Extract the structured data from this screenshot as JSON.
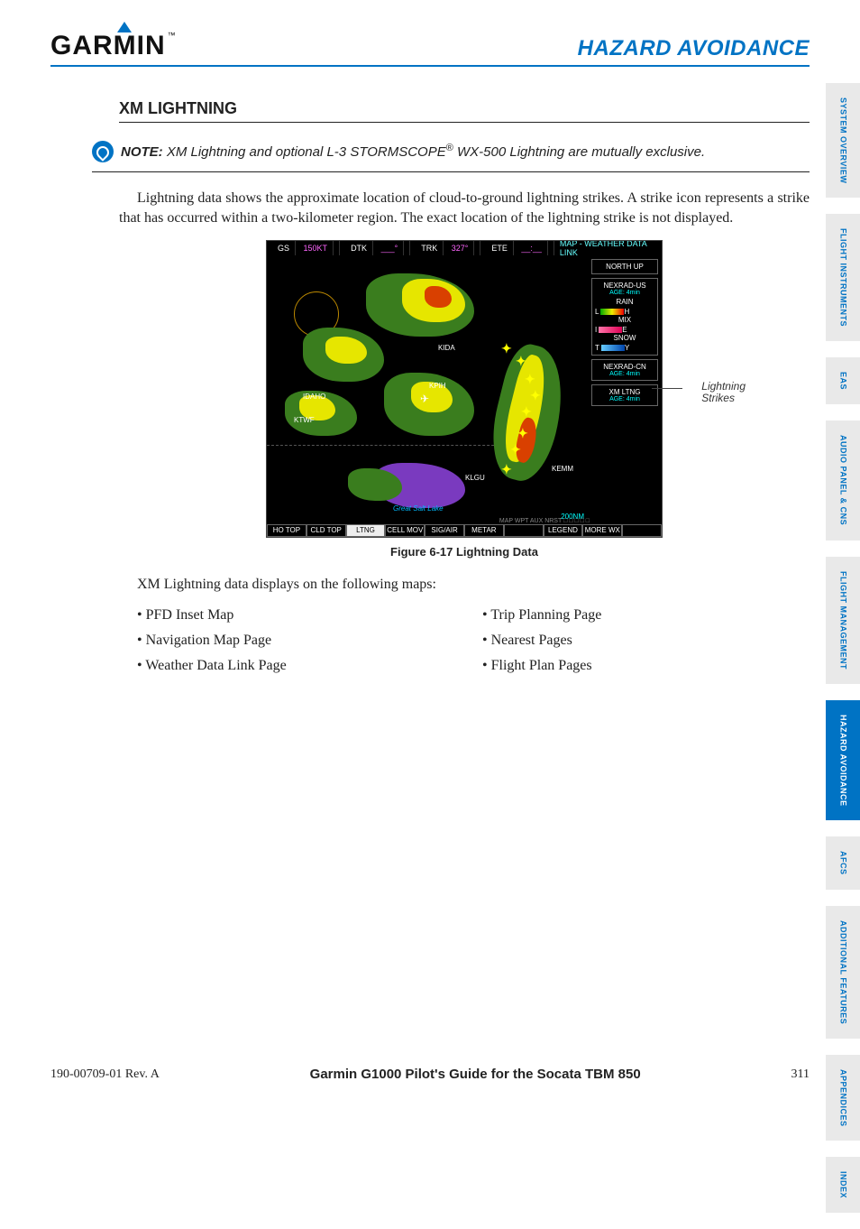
{
  "header": {
    "logo_text": "GARMIN",
    "title": "HAZARD AVOIDANCE"
  },
  "content": {
    "section_title": "XM LIGHTNING",
    "note_label": "NOTE:",
    "note_text": " XM Lightning and optional L-3 STORMSCOPE",
    "note_text2": " WX-500 Lightning are mutually exclusive.",
    "para1": "Lightning data shows the approximate location of cloud-to-ground lightning strikes. A strike icon represents a strike that has occurred within a two-kilometer region. The exact location of the lightning strike is not displayed.",
    "figure": {
      "top_bar": {
        "gs_label": "GS",
        "gs_val": "150KT",
        "dtk_label": "DTK",
        "dtk_val": "___°",
        "trk_label": "TRK",
        "trk_val": "327°",
        "ete_label": "ETE",
        "ete_val": "__:__",
        "title": "MAP - WEATHER DATA LINK"
      },
      "side_panel": {
        "north": "NORTH UP",
        "nexrad_us": "NEXRAD-US",
        "age1": "AGE: 4min",
        "rain": "RAIN",
        "mix": "MIX",
        "snow": "SNOW",
        "nexrad_cn": "NEXRAD-CN",
        "age2": "AGE: 4min",
        "xm": "XM LTNG",
        "age3": "AGE: 4min"
      },
      "waypoints": {
        "kida": "KIDA",
        "kpih": "KPIH",
        "idaho": "IDAHO",
        "ktwf": "KTWF",
        "klgu": "KLGU",
        "kemm": "KEMM",
        "lake": "Great Salt Lake"
      },
      "scale": "200NM",
      "map_aux": "MAP WPT AUX NRST □ □ □ □ □",
      "bottom_keys": [
        "HO TOP",
        "CLD TOP",
        "LTNG",
        "CELL MOV",
        "SIG/AIR",
        "METAR",
        "",
        "LEGEND",
        "MORE WX",
        ""
      ],
      "annotation": "Lightning Strikes",
      "caption": "Figure 6-17  Lightning Data"
    },
    "intro2": "XM Lightning data displays on the following maps:",
    "bullets_left": [
      "PFD Inset Map",
      "Navigation Map Page",
      "Weather Data Link Page"
    ],
    "bullets_right": [
      "Trip Planning Page",
      "Nearest Pages",
      "Flight Plan Pages"
    ]
  },
  "tabs": [
    {
      "label": "SYSTEM OVERVIEW",
      "active": false
    },
    {
      "label": "FLIGHT INSTRUMENTS",
      "active": false
    },
    {
      "label": "EAS",
      "active": false
    },
    {
      "label": "AUDIO PANEL & CNS",
      "active": false
    },
    {
      "label": "FLIGHT MANAGEMENT",
      "active": false
    },
    {
      "label": "HAZARD AVOIDANCE",
      "active": true
    },
    {
      "label": "AFCS",
      "active": false
    },
    {
      "label": "ADDITIONAL FEATURES",
      "active": false
    },
    {
      "label": "APPENDICES",
      "active": false
    },
    {
      "label": "INDEX",
      "active": false
    }
  ],
  "footer": {
    "left": "190-00709-01  Rev. A",
    "center": "Garmin G1000 Pilot's Guide for the Socata TBM 850",
    "page": "311"
  }
}
